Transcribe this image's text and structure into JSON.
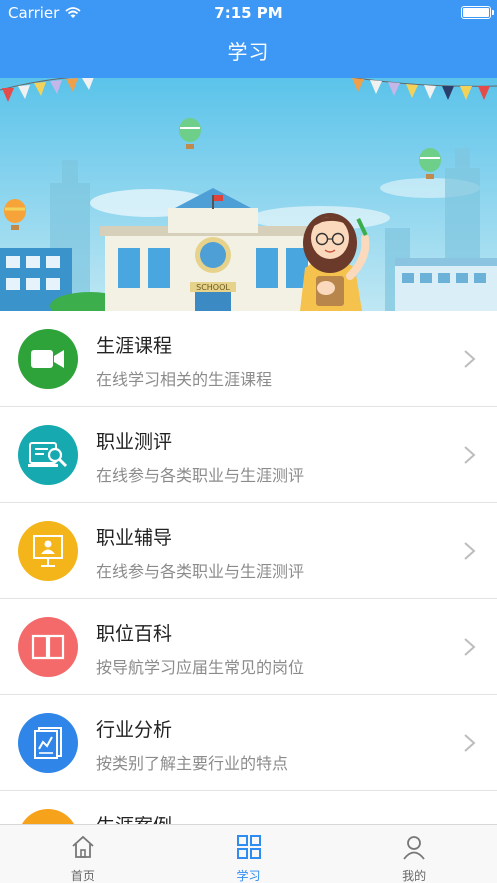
{
  "status_bar": {
    "carrier": "Carrier",
    "time": "7:15 PM"
  },
  "header": {
    "title": "学习"
  },
  "banner": {
    "sign_text": "SCHOOL"
  },
  "list": [
    {
      "title": "生涯课程",
      "subtitle": "在线学习相关的生涯课程",
      "icon": "video-camera-icon",
      "color": "#2ea33a"
    },
    {
      "title": "职业测评",
      "subtitle": "在线参与各类职业与生涯测评",
      "icon": "magnifier-document-icon",
      "color": "#16aab0"
    },
    {
      "title": "职业辅导",
      "subtitle": "在线参与各类职业与生涯测评",
      "icon": "presentation-board-icon",
      "color": "#f3b51a"
    },
    {
      "title": "职位百科",
      "subtitle": "按导航学习应届生常见的岗位",
      "icon": "open-book-icon",
      "color": "#f46a6a"
    },
    {
      "title": "行业分析",
      "subtitle": "按类别了解主要行业的特点",
      "icon": "report-chart-icon",
      "color": "#2f86e8"
    },
    {
      "title": "生涯案例",
      "subtitle": "",
      "icon": "case-icon",
      "color": "#f7a21b"
    }
  ],
  "tabbar": {
    "tabs": [
      {
        "label": "首页",
        "icon": "home-icon",
        "active": false
      },
      {
        "label": "学习",
        "icon": "grid-icon",
        "active": true
      },
      {
        "label": "我的",
        "icon": "user-icon",
        "active": false
      }
    ]
  },
  "colors": {
    "header": "#3d97f4",
    "active_tab": "#2f8cf0"
  }
}
